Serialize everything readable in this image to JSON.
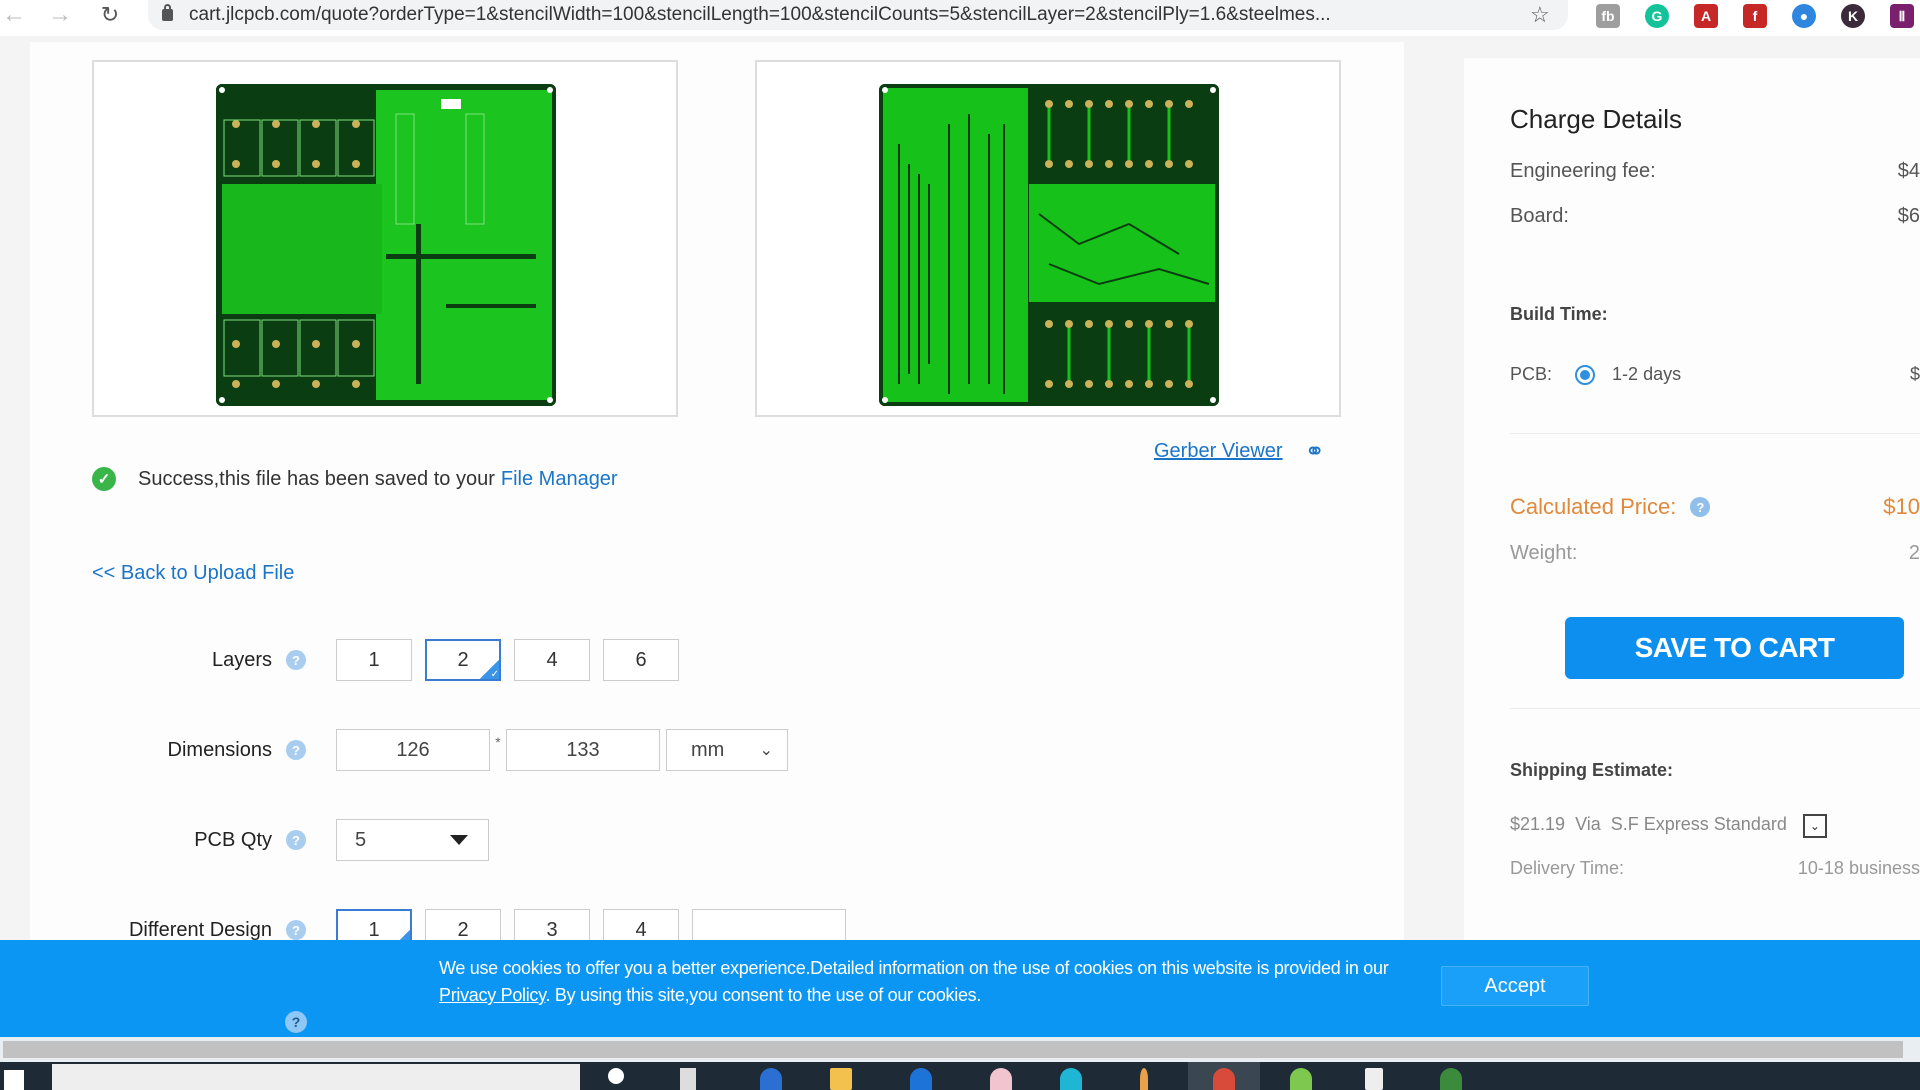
{
  "browser": {
    "url": "cart.jlcpcb.com/quote?orderType=1&stencilWidth=100&stencilLength=100&stencilCounts=5&stencilLayer=2&stencilPly=1.6&steelmes...",
    "extensions": [
      {
        "name": "fb-extension",
        "glyph": "fb",
        "color": "#9e9e9e"
      },
      {
        "name": "grammarly-extension",
        "glyph": "G",
        "color": "#15c39a"
      },
      {
        "name": "acrobat-extension",
        "glyph": "A",
        "color": "#c62828"
      },
      {
        "name": "flash-extension",
        "glyph": "f",
        "color": "#c62828"
      },
      {
        "name": "globe-extension",
        "glyph": "●",
        "color": "#2e86de"
      },
      {
        "name": "k-extension",
        "glyph": "K",
        "color": "#3a2a3a"
      },
      {
        "name": "ii-extension",
        "glyph": "Ⅱ",
        "color": "#7a1f6e"
      }
    ]
  },
  "preview": {
    "top_alt": "PCB top layer preview",
    "bottom_alt": "PCB bottom layer preview",
    "gerber_link": "Gerber Viewer"
  },
  "status": {
    "success_text": "Success,this file has been saved to your",
    "file_manager_link": "File Manager",
    "back_link": "<< Back to Upload File"
  },
  "form": {
    "layers": {
      "label": "Layers",
      "options": [
        "1",
        "2",
        "4",
        "6"
      ],
      "selected": "2"
    },
    "dimensions": {
      "label": "Dimensions",
      "width": "126",
      "length": "133",
      "separator": "*",
      "unit": "mm"
    },
    "pcb_qty": {
      "label": "PCB Qty",
      "value": "5"
    },
    "different_design": {
      "label": "Different Design",
      "options": [
        "1",
        "2",
        "3",
        "4"
      ],
      "selected": "1",
      "custom_value": ""
    },
    "help_glyph": "?"
  },
  "charge": {
    "title": "Charge Details",
    "engineering_fee_label": "Engineering fee:",
    "engineering_fee_value": "$4",
    "board_label": "Board:",
    "board_value": "$6",
    "build_time_label": "Build Time:",
    "pcb_label": "PCB:",
    "pcb_option": "1-2 days",
    "pcb_value": "$",
    "calculated_price_label": "Calculated Price:",
    "calculated_price_value": "$10",
    "weight_label": "Weight:",
    "weight_value": "2",
    "save_button": "SAVE TO CART",
    "shipping_label": "Shipping Estimate:",
    "shipping_price": "$21.19",
    "shipping_via": "Via",
    "shipping_method": "S.F Express Standard",
    "delivery_label": "Delivery Time:",
    "delivery_value": "10-18 business"
  },
  "cookie": {
    "text_1": "We use cookies to offer you a better experience.Detailed information on the use of cookies on this website is provided in our",
    "privacy_link": "Privacy Policy",
    "text_2": ". By using this site,you consent to the use of our cookies.",
    "accept_button": "Accept"
  },
  "colors": {
    "brand_blue": "#0d8ff0",
    "link_blue": "#1a75c9",
    "price_orange": "#e0893a",
    "success_green": "#3ab54a",
    "cookie_blue": "#0a96f2"
  }
}
